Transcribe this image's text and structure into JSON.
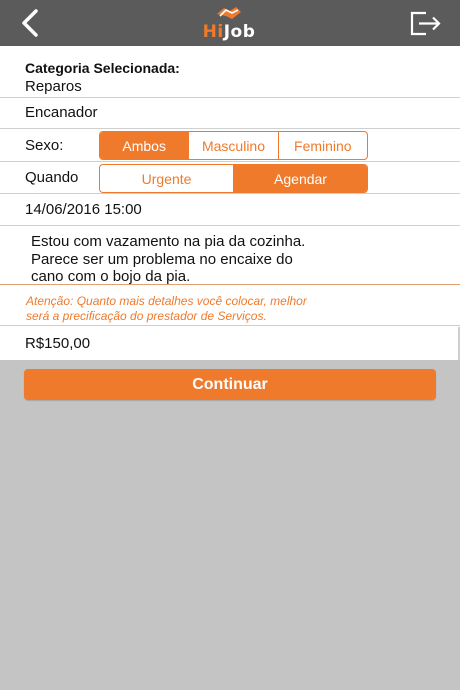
{
  "header": {
    "logo_hi": "Hi",
    "logo_job": "Job",
    "icons": {
      "back": "chevron-left-icon",
      "logout": "logout-icon",
      "logo": "handshake-icon"
    }
  },
  "form": {
    "category_title": "Categoria Selecionada:",
    "category": "Reparos",
    "subcategory": "Encanador",
    "sexo": {
      "label": "Sexo:",
      "options": [
        "Ambos",
        "Masculino",
        "Feminino"
      ],
      "selected": "Ambos"
    },
    "quando": {
      "label": "Quando",
      "options": [
        "Urgente",
        "Agendar"
      ],
      "selected": "Agendar"
    },
    "datetime": "14/06/2016 15:00",
    "description_lines": [
      "Estou com vazamento na pia da cozinha.",
      "Parece ser um problema no encaixe do",
      "cano com o bojo da pia."
    ],
    "warning_lines": [
      "Atenção: Quanto mais detalhes você colocar, melhor",
      "será a precificação do prestador de Serviços."
    ],
    "price": "R$150,00"
  },
  "continue_label": "Continuar",
  "colors": {
    "accent": "#f07a2c",
    "topbar": "#5b5b5b",
    "background": "#c4c4c4"
  }
}
